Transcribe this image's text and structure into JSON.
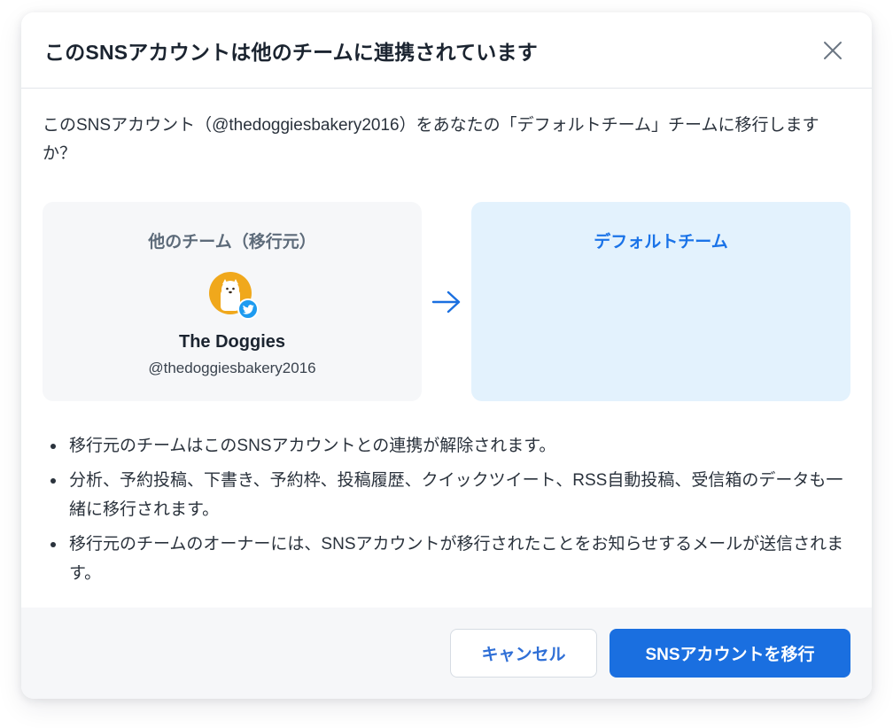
{
  "dialog": {
    "title": "このSNSアカウントは他のチームに連携されています",
    "close_icon": "close-icon",
    "question": "このSNSアカウント（@thedoggiesbakery2016）をあなたの「デフォルトチーム」チームに移行しますか？",
    "from_card": {
      "title": "他のチーム（移行元）",
      "account_name": "The Doggies",
      "account_handle": "@thedoggiesbakery2016",
      "avatar_color": "#f0a81c",
      "badge_icon": "twitter-icon",
      "badge_color": "#1d9bf0"
    },
    "arrow_icon": "arrow-right-icon",
    "to_card": {
      "title": "デフォルトチーム",
      "background": "#e3f2fd"
    },
    "notes": [
      "移行元のチームはこのSNSアカウントとの連携が解除されます。",
      "分析、予約投稿、下書き、予約枠、投稿履歴、クイックツイート、RSS自動投稿、受信箱のデータも一緒に移行されます。",
      "移行元のチームのオーナーには、SNSアカウントが移行されたことをお知らせするメールが送信されます。"
    ],
    "buttons": {
      "cancel": "キャンセル",
      "confirm": "SNSアカウントを移行"
    },
    "accent_color": "#1a6fe0"
  }
}
